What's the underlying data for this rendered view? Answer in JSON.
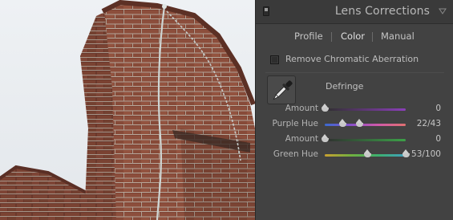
{
  "panel": {
    "title": "Lens Corrections",
    "tabs": [
      "Profile",
      "Color",
      "Manual"
    ],
    "active_tab": "Color",
    "remove_ca_label": "Remove Chromatic Aberration",
    "remove_ca_checked": false,
    "defringe_label": "Defringe",
    "sliders": [
      {
        "label": "Amount",
        "value": "0",
        "fraction": 0.0
      },
      {
        "label": "Purple Hue",
        "value": "22/43",
        "fraction_low": 0.22,
        "fraction_high": 0.43
      },
      {
        "label": "Amount",
        "value": "0",
        "fraction": 0.0
      },
      {
        "label": "Green Hue",
        "value": "53/100",
        "fraction_low": 0.53,
        "fraction_high": 1.0
      }
    ]
  },
  "colors": {
    "panel_bg": "#424242",
    "header_bg": "#3a3a3a",
    "text": "#c0c0c0",
    "brick": "#8a4a38"
  },
  "icons": [
    "solo-switch-icon",
    "collapse-triangle-icon",
    "eyedropper-icon",
    "slider-thumb-icon"
  ]
}
